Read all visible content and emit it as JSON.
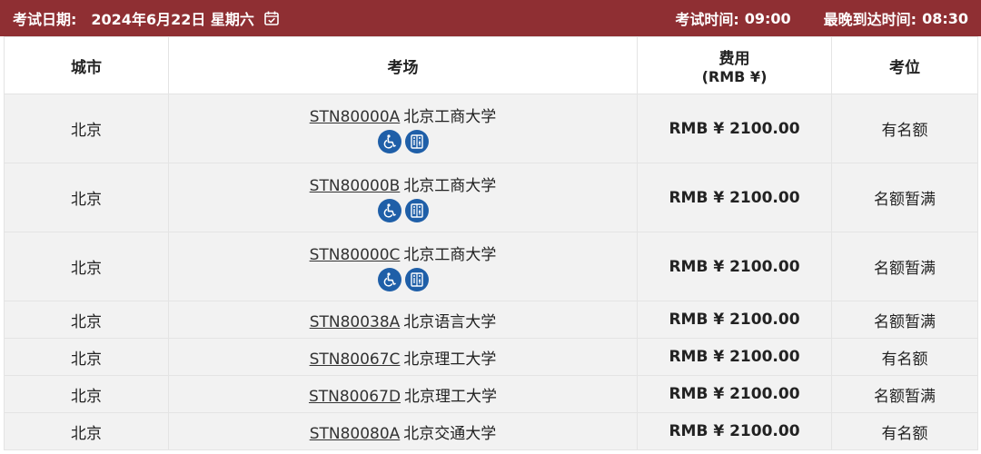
{
  "header": {
    "exam_date_label": "考试日期:",
    "exam_date_value": "2024年6月22日 星期六",
    "calendar_icon": "calendar-check-icon",
    "exam_time_label": "考试时间:",
    "exam_time_value": "09:00",
    "latest_arrival_label": "最晚到达时间:",
    "latest_arrival_value": "08:30"
  },
  "table": {
    "columns": {
      "city": "城市",
      "venue": "考场",
      "fee_line1": "费用",
      "fee_line2": "(RMB ¥)",
      "seats": "考位"
    },
    "rows": [
      {
        "city": "北京",
        "code": "STN80000A",
        "name": "北京工商大学",
        "fee": "RMB ¥ 2100.00",
        "seats": "有名额",
        "icons": [
          "wheelchair-icon",
          "restroom-icon"
        ]
      },
      {
        "city": "北京",
        "code": "STN80000B",
        "name": "北京工商大学",
        "fee": "RMB ¥ 2100.00",
        "seats": "名额暂满",
        "icons": [
          "wheelchair-icon",
          "restroom-icon"
        ]
      },
      {
        "city": "北京",
        "code": "STN80000C",
        "name": "北京工商大学",
        "fee": "RMB ¥ 2100.00",
        "seats": "名额暂满",
        "icons": [
          "wheelchair-icon",
          "restroom-icon"
        ]
      },
      {
        "city": "北京",
        "code": "STN80038A",
        "name": "北京语言大学",
        "fee": "RMB ¥ 2100.00",
        "seats": "名额暂满",
        "icons": []
      },
      {
        "city": "北京",
        "code": "STN80067C",
        "name": "北京理工大学",
        "fee": "RMB ¥ 2100.00",
        "seats": "有名额",
        "icons": []
      },
      {
        "city": "北京",
        "code": "STN80067D",
        "name": "北京理工大学",
        "fee": "RMB ¥ 2100.00",
        "seats": "名额暂满",
        "icons": []
      },
      {
        "city": "北京",
        "code": "STN80080A",
        "name": "北京交通大学",
        "fee": "RMB ¥ 2100.00",
        "seats": "有名额",
        "icons": []
      }
    ]
  },
  "colors": {
    "header_bg": "#8f2f33",
    "row_bg": "#f2f2f2",
    "icon_badge": "#1f5fa8"
  }
}
